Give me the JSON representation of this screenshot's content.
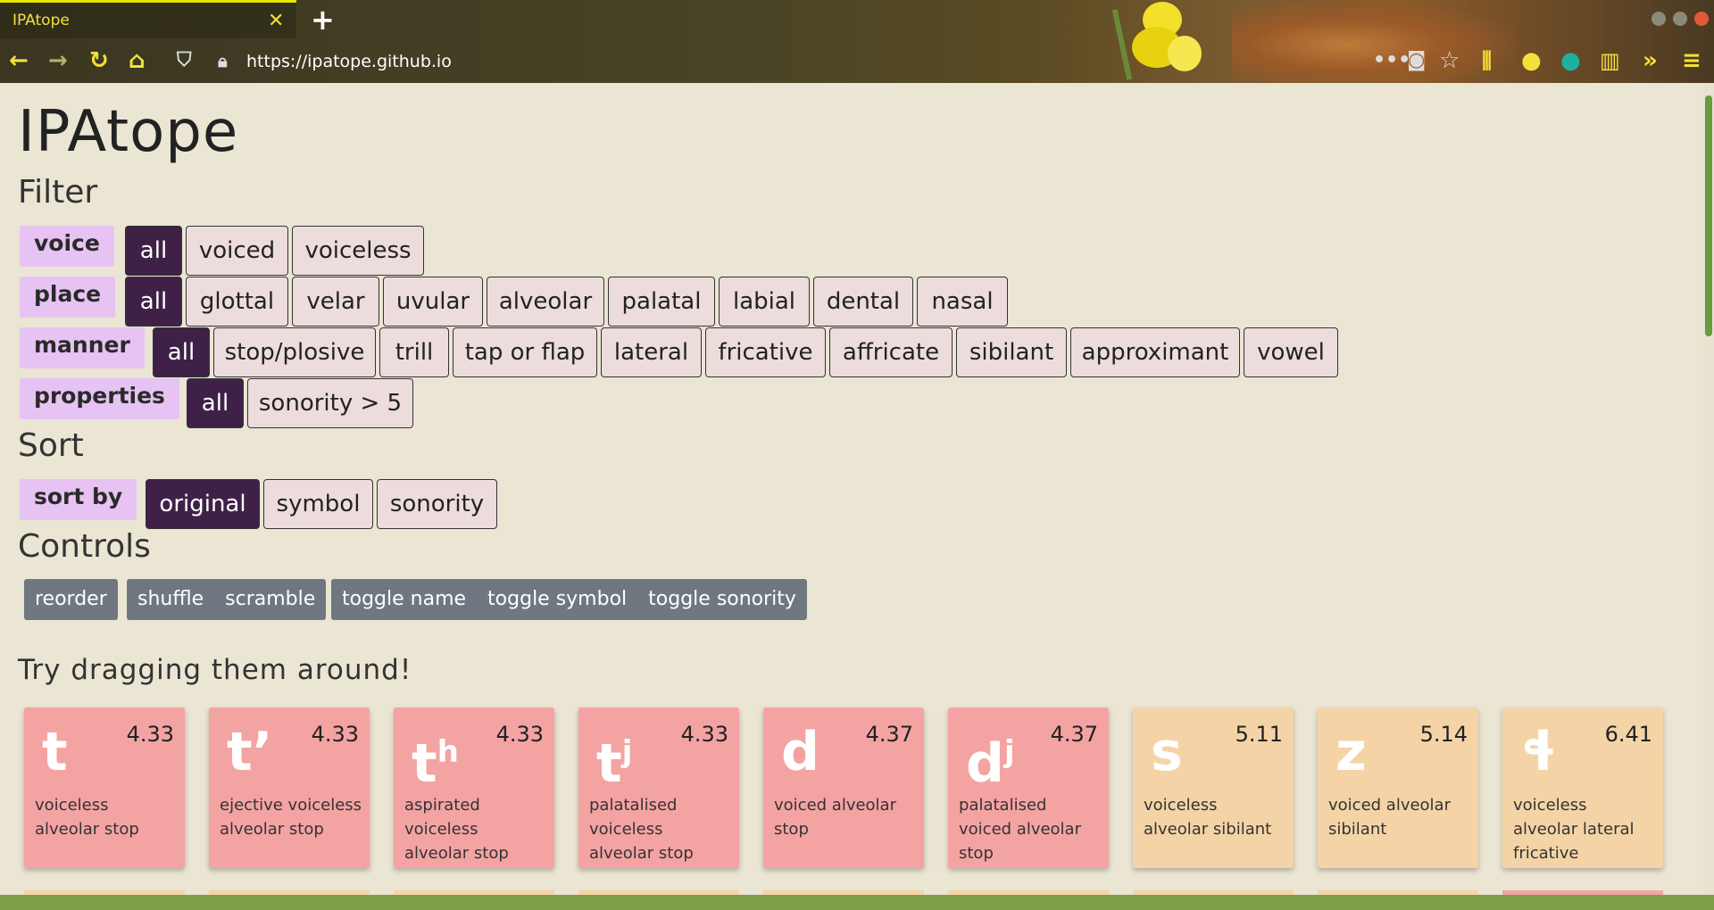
{
  "browser": {
    "tab_title": "IPAtope",
    "url": "https://ipatope.github.io"
  },
  "page": {
    "title": "IPAtope",
    "filter_heading": "Filter",
    "sort_heading": "Sort",
    "controls_heading": "Controls",
    "drag_hint": "Try dragging them around!"
  },
  "filters": {
    "voice": {
      "label": "voice",
      "options": [
        "all",
        "voiced",
        "voiceless"
      ],
      "selected": "all"
    },
    "place": {
      "label": "place",
      "options": [
        "all",
        "glottal",
        "velar",
        "uvular",
        "alveolar",
        "palatal",
        "labial",
        "dental",
        "nasal"
      ],
      "selected": "all"
    },
    "manner": {
      "label": "manner",
      "options": [
        "all",
        "stop/plosive",
        "trill",
        "tap or flap",
        "lateral",
        "fricative",
        "affricate",
        "sibilant",
        "approximant",
        "vowel"
      ],
      "selected": "all"
    },
    "properties": {
      "label": "properties",
      "options": [
        "all",
        "sonority > 5"
      ],
      "selected": "all"
    }
  },
  "sort": {
    "label": "sort by",
    "options": [
      "original",
      "symbol",
      "sonority"
    ],
    "selected": "original"
  },
  "controls": {
    "group1": [
      "reorder"
    ],
    "group2": [
      "shuffle",
      "scramble"
    ],
    "group3": [
      "toggle name",
      "toggle symbol",
      "toggle sonority"
    ]
  },
  "cards": [
    {
      "symbol": "t",
      "sup": "",
      "sonority": "4.33",
      "name": "voiceless alveolar stop",
      "color": "pink"
    },
    {
      "symbol": "t’",
      "sup": "",
      "sonority": "4.33",
      "name": "ejective voiceless alveolar stop",
      "color": "pink"
    },
    {
      "symbol": "t",
      "sup": "h",
      "sonority": "4.33",
      "name": "aspirated voiceless alveolar stop",
      "color": "pink"
    },
    {
      "symbol": "t",
      "sup": "j",
      "sonority": "4.33",
      "name": "palatalised voiceless alveolar stop",
      "color": "pink"
    },
    {
      "symbol": "d",
      "sup": "",
      "sonority": "4.37",
      "name": "voiced alveolar stop",
      "color": "pink"
    },
    {
      "symbol": "d",
      "sup": "j",
      "sonority": "4.37",
      "name": "palatalised voiced alveolar stop",
      "color": "pink"
    },
    {
      "symbol": "s",
      "sup": "",
      "sonority": "5.11",
      "name": "voiceless alveolar sibilant",
      "color": "tan"
    },
    {
      "symbol": "z",
      "sup": "",
      "sonority": "5.14",
      "name": "voiced alveolar sibilant",
      "color": "tan"
    },
    {
      "symbol": "ɬ",
      "sup": "",
      "sonority": "6.41",
      "name": "voiceless alveolar lateral fricative",
      "color": "tan"
    }
  ],
  "colors": {
    "active": "#3f2148",
    "pink": "#f4a3a3",
    "tan": "#f4d4a6",
    "label_bg": "#e6c3f2",
    "control_bg": "#6f7880"
  },
  "icons": [
    "back-icon",
    "forward-icon",
    "reload-icon",
    "home-icon",
    "shield-icon",
    "lock-icon",
    "more-icon",
    "pocket-icon",
    "star-icon",
    "library-icon",
    "account-icon",
    "extension-icon",
    "sidebar-icon",
    "overflow-icon",
    "menu-icon"
  ]
}
